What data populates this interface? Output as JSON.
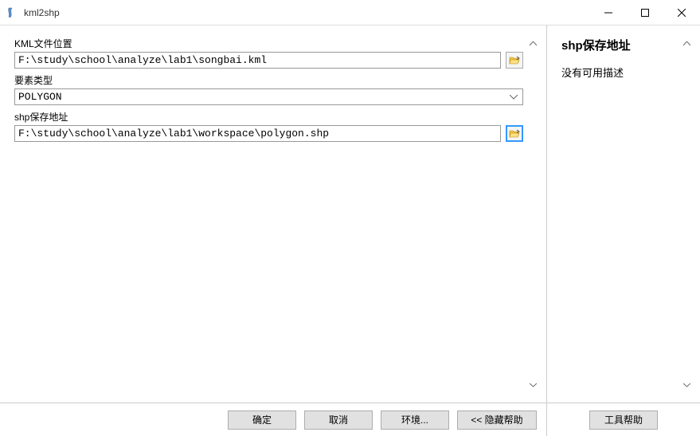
{
  "window": {
    "title": "kml2shp"
  },
  "fields": {
    "kml_location": {
      "label": "KML文件位置",
      "value": "F:\\study\\school\\analyze\\lab1\\songbai.kml"
    },
    "element_type": {
      "label": "要素类型",
      "value": "POLYGON"
    },
    "shp_save": {
      "label": "shp保存地址",
      "value": "F:\\study\\school\\analyze\\lab1\\workspace\\polygon.shp"
    }
  },
  "buttons": {
    "ok": "确定",
    "cancel": "取消",
    "environment": "环境...",
    "hide_help": "<< 隐藏帮助",
    "tool_help": "工具帮助"
  },
  "help": {
    "title": "shp保存地址",
    "description": "没有可用描述"
  }
}
